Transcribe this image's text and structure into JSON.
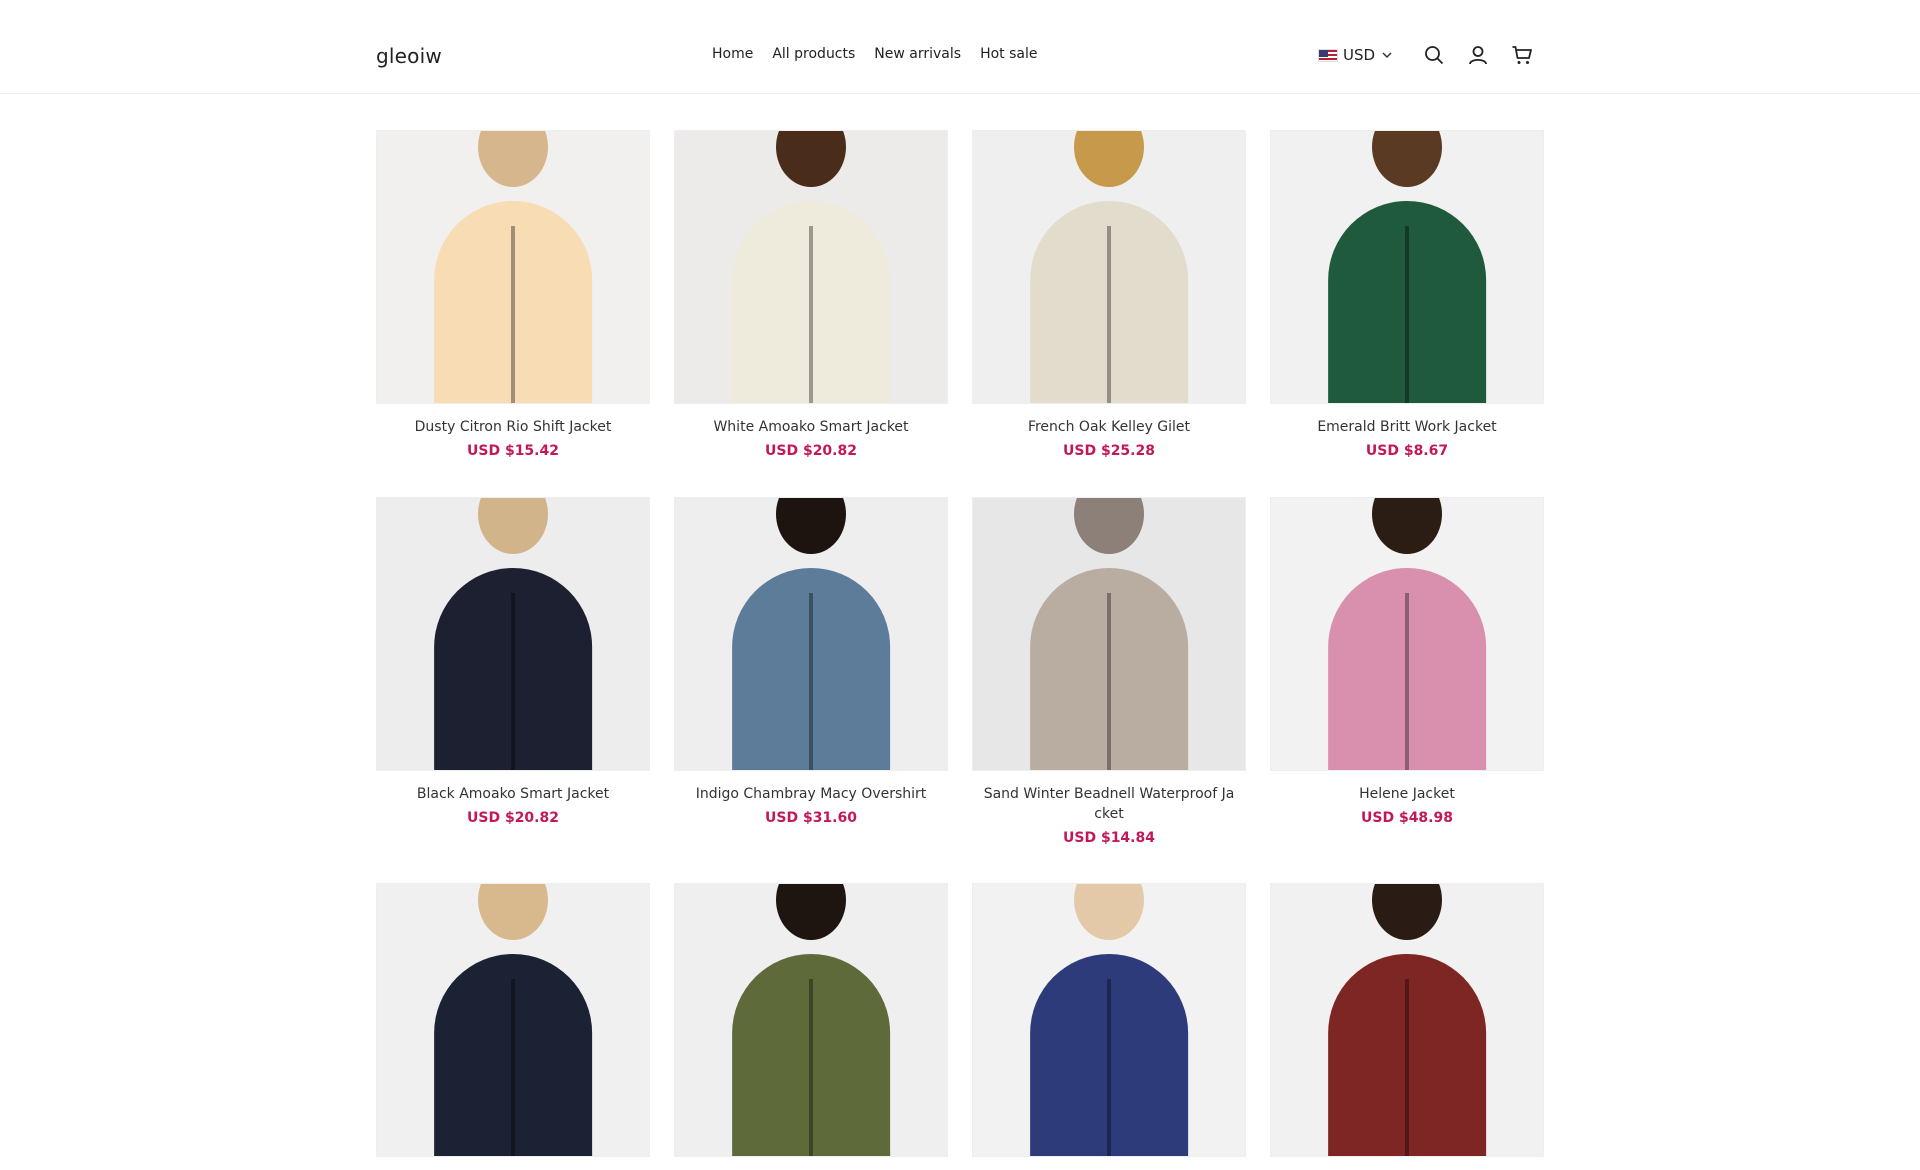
{
  "header": {
    "logo": "gleoiw",
    "nav": [
      "Home",
      "All products",
      "New arrivals",
      "Hot sale"
    ],
    "currency": "USD",
    "icons": [
      "search-icon",
      "account-icon",
      "cart-icon"
    ]
  },
  "products": [
    {
      "name": "Dusty Citron Rio Shift Jacket",
      "price": "USD $15.42",
      "bg": "#f1f0ee",
      "color": "#f7dcb4",
      "hair": "#d6b68c"
    },
    {
      "name": "White Amoako Smart Jacket",
      "price": "USD $20.82",
      "bg": "#ecebea",
      "color": "#eeeadc",
      "hair": "#4a2c1a"
    },
    {
      "name": "French Oak Kelley Gilet",
      "price": "USD $25.28",
      "bg": "#efefef",
      "color": "#e1dccb",
      "hair": "#c79a4b"
    },
    {
      "name": "Emerald Britt Work Jacket",
      "price": "USD $8.67",
      "bg": "#f1f1f1",
      "color": "#1f5a3c",
      "hair": "#5a3a22"
    },
    {
      "name": "Black Amoako Smart Jacket",
      "price": "USD $20.82",
      "bg": "#ededee",
      "color": "#1c2030",
      "hair": "#d1b48a"
    },
    {
      "name": "Indigo Chambray Macy Overshirt",
      "price": "USD $31.60",
      "bg": "#eeeeee",
      "color": "#5d7c99",
      "hair": "#1d140f"
    },
    {
      "name": "Sand Winter Beadnell Waterproof Jacket",
      "price": "USD $14.84",
      "bg": "#e7e7e7",
      "color": "#b9ada2",
      "hair": "#8c8079"
    },
    {
      "name": "Helene Jacket",
      "price": "USD $48.98",
      "bg": "#f2f2f2",
      "color": "#d98fae",
      "hair": "#2b1d14"
    },
    {
      "name": "",
      "price": "",
      "bg": "#f0f0f0",
      "color": "#1b2233",
      "hair": "#d7b98d"
    },
    {
      "name": "",
      "price": "",
      "bg": "#efefef",
      "color": "#5f6a3b",
      "hair": "#1e1510"
    },
    {
      "name": "",
      "price": "",
      "bg": "#f2f2f2",
      "color": "#2e3b7a",
      "hair": "#e4c9a9"
    },
    {
      "name": "",
      "price": "",
      "bg": "#f1f1f1",
      "color": "#7e2624",
      "hair": "#2a1b14"
    }
  ]
}
